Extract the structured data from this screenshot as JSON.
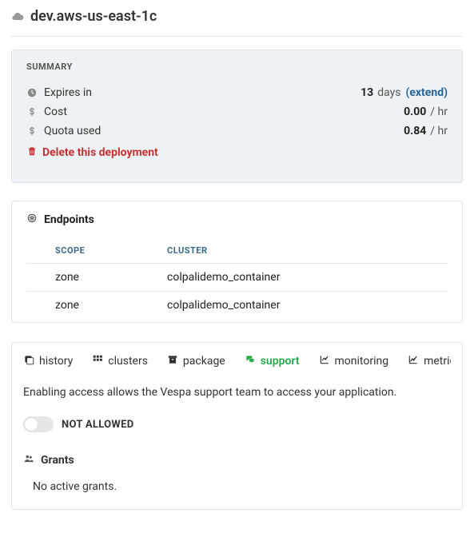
{
  "header": {
    "title": "dev.aws-us-east-1c"
  },
  "summary": {
    "title": "SUMMARY",
    "rows": {
      "expires": {
        "label": "Expires in",
        "value": "13",
        "unit": "days",
        "extend": "(extend)"
      },
      "cost": {
        "label": "Cost",
        "value": "0.00",
        "unit": "/ hr"
      },
      "quota": {
        "label": "Quota used",
        "value": "0.84",
        "unit": "/ hr"
      }
    },
    "delete_label": "Delete this deployment"
  },
  "endpoints": {
    "title": "Endpoints",
    "columns": {
      "scope": "SCOPE",
      "cluster": "CLUSTER"
    },
    "rows": [
      {
        "scope": "zone",
        "cluster": "colpalidemo_container"
      },
      {
        "scope": "zone",
        "cluster": "colpalidemo_container"
      }
    ]
  },
  "tabs": {
    "history": "history",
    "clusters": "clusters",
    "package": "package",
    "support": "support",
    "monitoring": "monitoring",
    "metrics": "metrics"
  },
  "support": {
    "note": "Enabling access allows the Vespa support team to access your application.",
    "toggle_label": "NOT ALLOWED",
    "grants_title": "Grants",
    "grants_empty": "No active grants."
  }
}
